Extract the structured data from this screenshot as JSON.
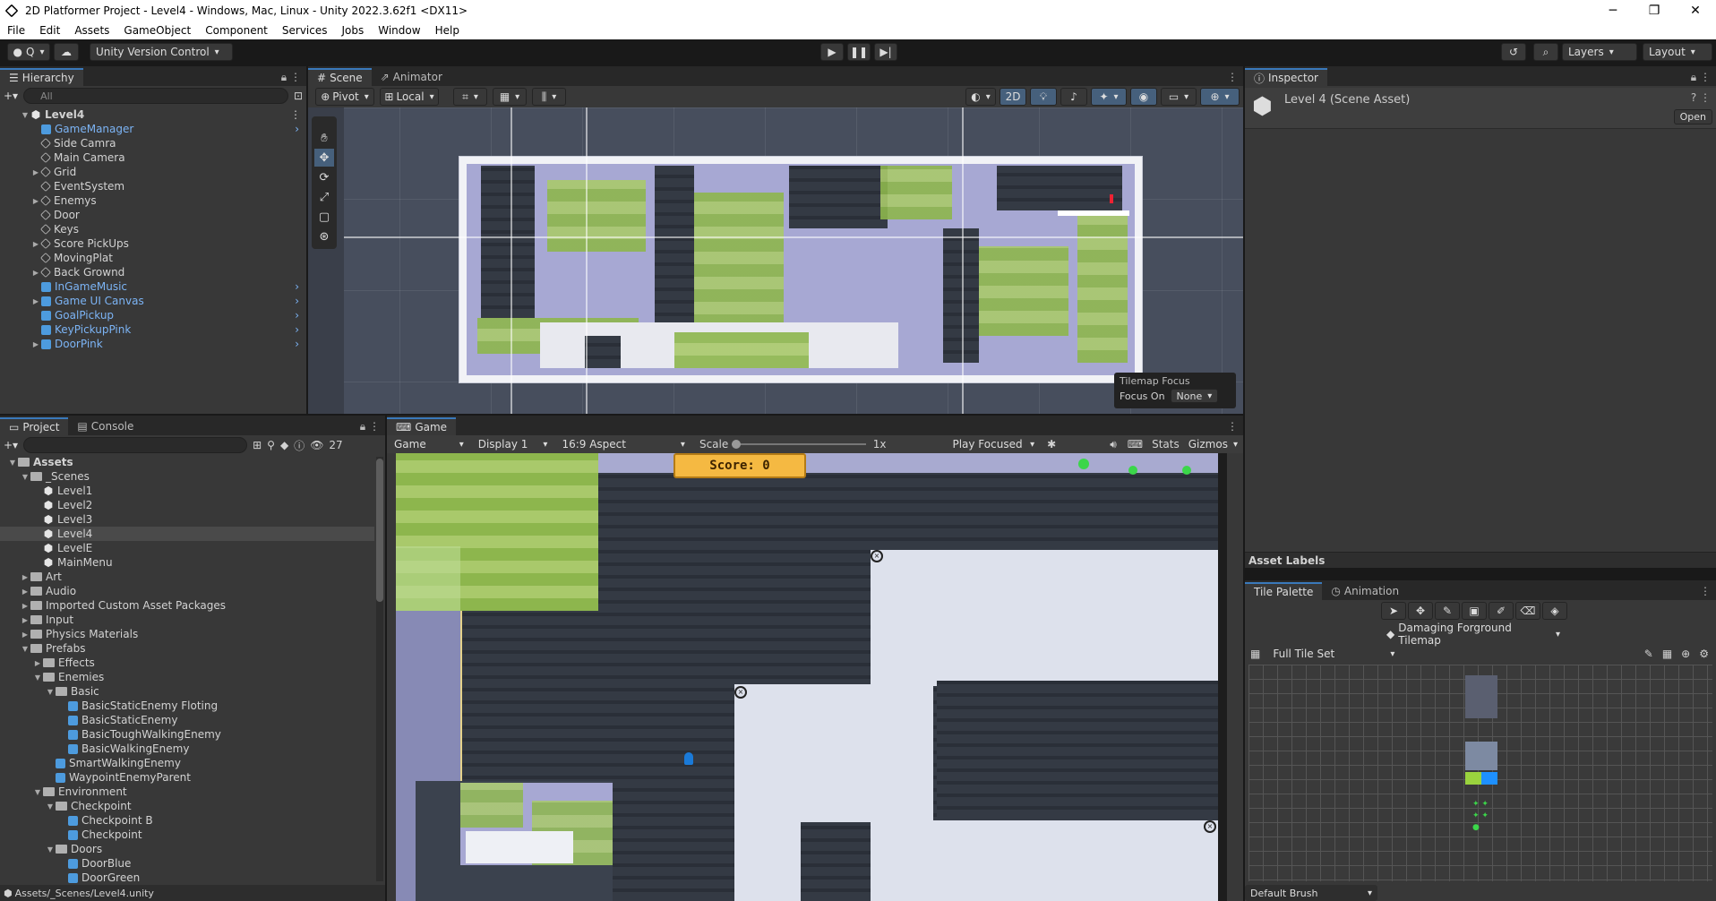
{
  "window": {
    "title": "2D Platformer Project - Level4 - Windows, Mac, Linux - Unity 2022.3.62f1 <DX11>",
    "minimize": "─",
    "maximize": "❐",
    "close": "✕"
  },
  "menu": [
    "File",
    "Edit",
    "Assets",
    "GameObject",
    "Component",
    "Services",
    "Jobs",
    "Window",
    "Help"
  ],
  "toolbar": {
    "account": "Q",
    "version_control": "Unity Version Control",
    "layers": "Layers",
    "layout": "Layout"
  },
  "hierarchy": {
    "tab": "Hierarchy",
    "search_placeholder": "All",
    "root": "Level4",
    "items": [
      {
        "label": "GameManager",
        "prefab": true,
        "expand": false,
        "chevron": true
      },
      {
        "label": "Side Camra",
        "prefab": false,
        "expand": false,
        "chevron": false
      },
      {
        "label": "Main Camera",
        "prefab": false,
        "expand": false,
        "chevron": false
      },
      {
        "label": "Grid",
        "prefab": false,
        "expand": true,
        "chevron": false
      },
      {
        "label": "EventSystem",
        "prefab": false,
        "expand": false,
        "chevron": false
      },
      {
        "label": "Enemys",
        "prefab": false,
        "expand": true,
        "chevron": false
      },
      {
        "label": "Door",
        "prefab": false,
        "expand": false,
        "chevron": false
      },
      {
        "label": "Keys",
        "prefab": false,
        "expand": false,
        "chevron": false
      },
      {
        "label": "Score PickUps",
        "prefab": false,
        "expand": true,
        "chevron": false
      },
      {
        "label": "MovingPlat",
        "prefab": false,
        "expand": false,
        "chevron": false
      },
      {
        "label": "Back Grownd",
        "prefab": false,
        "expand": true,
        "chevron": false
      },
      {
        "label": "InGameMusic",
        "prefab": true,
        "expand": false,
        "chevron": true
      },
      {
        "label": "Game UI Canvas",
        "prefab": true,
        "expand": true,
        "chevron": true
      },
      {
        "label": "GoalPickup",
        "prefab": true,
        "expand": false,
        "chevron": true
      },
      {
        "label": "KeyPickupPink",
        "prefab": true,
        "expand": false,
        "chevron": true
      },
      {
        "label": "DoorPink",
        "prefab": true,
        "expand": true,
        "chevron": true
      }
    ]
  },
  "scene": {
    "tabs": [
      "Scene",
      "Animator"
    ],
    "pivot": "Pivot",
    "local": "Local",
    "mode_2d": "2D",
    "tilemap_focus": {
      "title": "Tilemap Focus",
      "label": "Focus On",
      "value": "None"
    }
  },
  "inspector": {
    "tab": "Inspector",
    "title": "Level 4 (Scene Asset)",
    "open_button": "Open",
    "asset_labels": "Asset Labels"
  },
  "project": {
    "tabs": [
      "Project",
      "Console"
    ],
    "count": "27",
    "tree": [
      {
        "label": "Assets",
        "depth": 0,
        "kind": "folder",
        "expand": "down",
        "bold": true
      },
      {
        "label": "_Scenes",
        "depth": 1,
        "kind": "folder",
        "expand": "down"
      },
      {
        "label": "Level1",
        "depth": 2,
        "kind": "scene",
        "expand": ""
      },
      {
        "label": "Level2",
        "depth": 2,
        "kind": "scene",
        "expand": ""
      },
      {
        "label": "Level3",
        "depth": 2,
        "kind": "scene",
        "expand": ""
      },
      {
        "label": "Level4",
        "depth": 2,
        "kind": "scene",
        "expand": "",
        "highlight": true
      },
      {
        "label": "LevelE",
        "depth": 2,
        "kind": "scene",
        "expand": ""
      },
      {
        "label": "MainMenu",
        "depth": 2,
        "kind": "scene",
        "expand": ""
      },
      {
        "label": "Art",
        "depth": 1,
        "kind": "folder",
        "expand": "right"
      },
      {
        "label": "Audio",
        "depth": 1,
        "kind": "folder",
        "expand": "right"
      },
      {
        "label": "Imported Custom Asset Packages",
        "depth": 1,
        "kind": "folder",
        "expand": "right"
      },
      {
        "label": "Input",
        "depth": 1,
        "kind": "folder",
        "expand": "right"
      },
      {
        "label": "Physics Materials",
        "depth": 1,
        "kind": "folder",
        "expand": "right"
      },
      {
        "label": "Prefabs",
        "depth": 1,
        "kind": "folder",
        "expand": "down"
      },
      {
        "label": "Effects",
        "depth": 2,
        "kind": "folder",
        "expand": "right"
      },
      {
        "label": "Enemies",
        "depth": 2,
        "kind": "folder",
        "expand": "down"
      },
      {
        "label": "Basic",
        "depth": 3,
        "kind": "folder",
        "expand": "down"
      },
      {
        "label": "BasicStaticEnemy Floting",
        "depth": 4,
        "kind": "prefab",
        "expand": ""
      },
      {
        "label": "BasicStaticEnemy",
        "depth": 4,
        "kind": "prefab",
        "expand": ""
      },
      {
        "label": "BasicToughWalkingEnemy",
        "depth": 4,
        "kind": "prefab",
        "expand": ""
      },
      {
        "label": "BasicWalkingEnemy",
        "depth": 4,
        "kind": "prefab",
        "expand": ""
      },
      {
        "label": "SmartWalkingEnemy",
        "depth": 3,
        "kind": "prefab",
        "expand": ""
      },
      {
        "label": "WaypointEnemyParent",
        "depth": 3,
        "kind": "prefab",
        "expand": ""
      },
      {
        "label": "Environment",
        "depth": 2,
        "kind": "folder",
        "expand": "down"
      },
      {
        "label": "Checkpoint",
        "depth": 3,
        "kind": "folder",
        "expand": "down"
      },
      {
        "label": "Checkpoint B",
        "depth": 4,
        "kind": "prefab",
        "expand": ""
      },
      {
        "label": "Checkpoint",
        "depth": 4,
        "kind": "prefab",
        "expand": ""
      },
      {
        "label": "Doors",
        "depth": 3,
        "kind": "folder",
        "expand": "down"
      },
      {
        "label": "DoorBlue",
        "depth": 4,
        "kind": "prefab",
        "expand": ""
      },
      {
        "label": "DoorGreen",
        "depth": 4,
        "kind": "prefab",
        "expand": ""
      }
    ],
    "status_path": "Assets/_Scenes/Level4.unity"
  },
  "game": {
    "tab": "Game",
    "mode": "Game",
    "display": "Display 1",
    "aspect": "16:9 Aspect",
    "scale_label": "Scale",
    "scale_value": "1x",
    "play_focused": "Play Focused",
    "stats": "Stats",
    "gizmos": "Gizmos",
    "score": "Score: 0"
  },
  "tile_palette": {
    "tabs": [
      "Tile Palette",
      "Animation"
    ],
    "target": "Damaging Forground Tilemap",
    "palette": "Full Tile Set",
    "brush": "Default Brush"
  }
}
